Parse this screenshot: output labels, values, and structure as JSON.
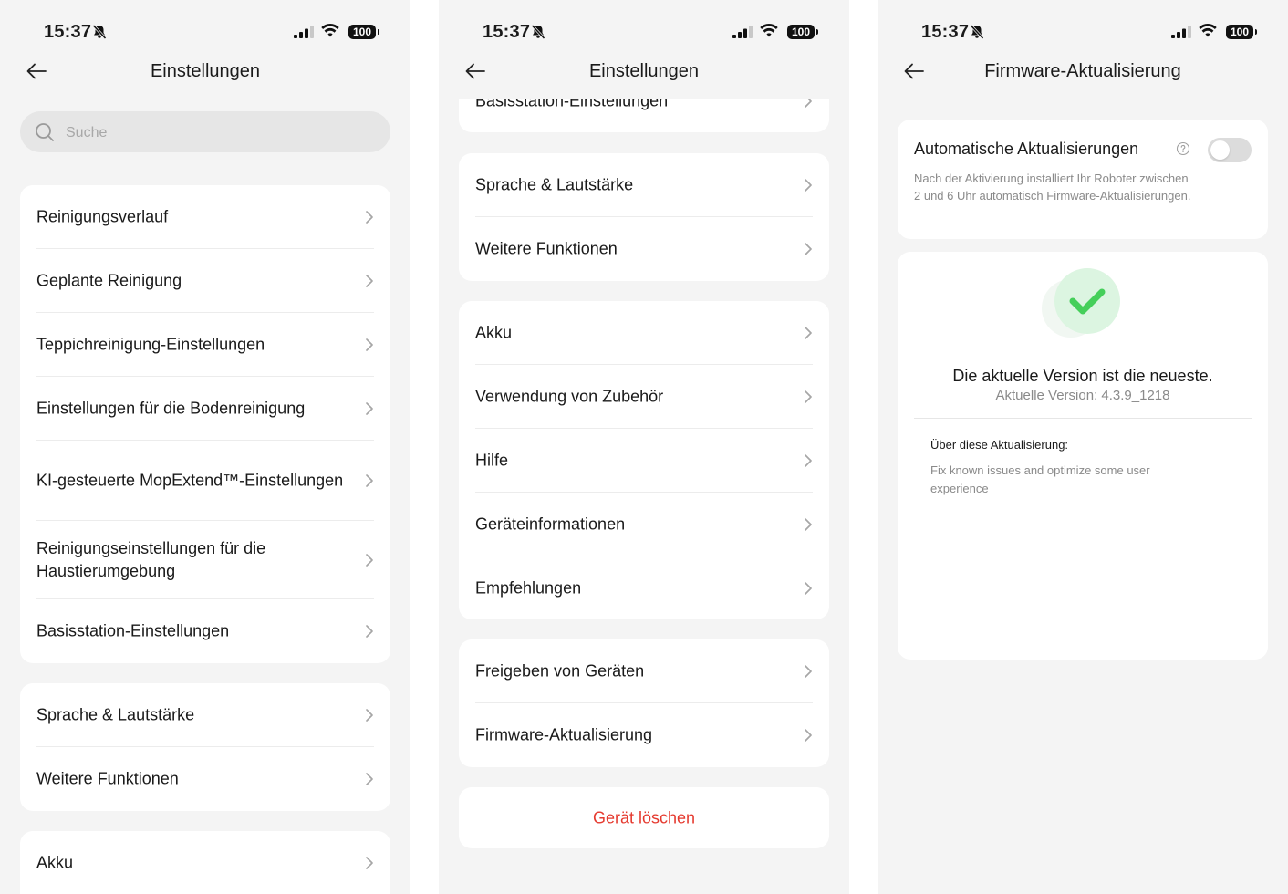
{
  "status_bar": {
    "time": "15:37",
    "battery": "100"
  },
  "screen1": {
    "title": "Einstellungen",
    "search_placeholder": "Suche",
    "group1": [
      "Reinigungsverlauf",
      "Geplante Reinigung",
      "Teppichreinigung-Einstellungen",
      "Einstellungen für die Bodenreinigung",
      "KI-gesteuerte MopExtend™-Einstellungen",
      "Reinigungseinstellungen für die Haustierumgebung",
      "Basisstation-Einstellungen"
    ],
    "group2": [
      "Sprache & Lautstärke",
      "Weitere Funktionen"
    ],
    "group3": [
      "Akku"
    ]
  },
  "screen2": {
    "title": "Einstellungen",
    "partial_item": "Basisstation-Einstellungen",
    "group1": [
      "Sprache & Lautstärke",
      "Weitere Funktionen"
    ],
    "group2": [
      "Akku",
      "Verwendung von Zubehör",
      "Hilfe",
      "Geräteinformationen",
      "Empfehlungen"
    ],
    "group3": [
      "Freigeben von Geräten",
      "Firmware-Aktualisierung"
    ],
    "delete_label": "Gerät löschen"
  },
  "screen3": {
    "title": "Firmware-Aktualisierung",
    "auto_update_title": "Automatische Aktualisierungen",
    "auto_update_enabled": false,
    "auto_update_desc": "Nach der Aktivierung installiert Ihr Roboter zwischen 2 und 6 Uhr automatisch Firmware-Aktualisierungen.",
    "status_text": "Die aktuelle Version ist die neueste.",
    "version_text": "Aktuelle Version: 4.3.9_1218",
    "about_title": "Über diese Aktualisierung:",
    "release_notes": "Fix known issues and optimize some user experience"
  },
  "colors": {
    "background": "#f4f4f4",
    "card": "#ffffff",
    "danger": "#e53a2f",
    "success": "#4cd964"
  }
}
